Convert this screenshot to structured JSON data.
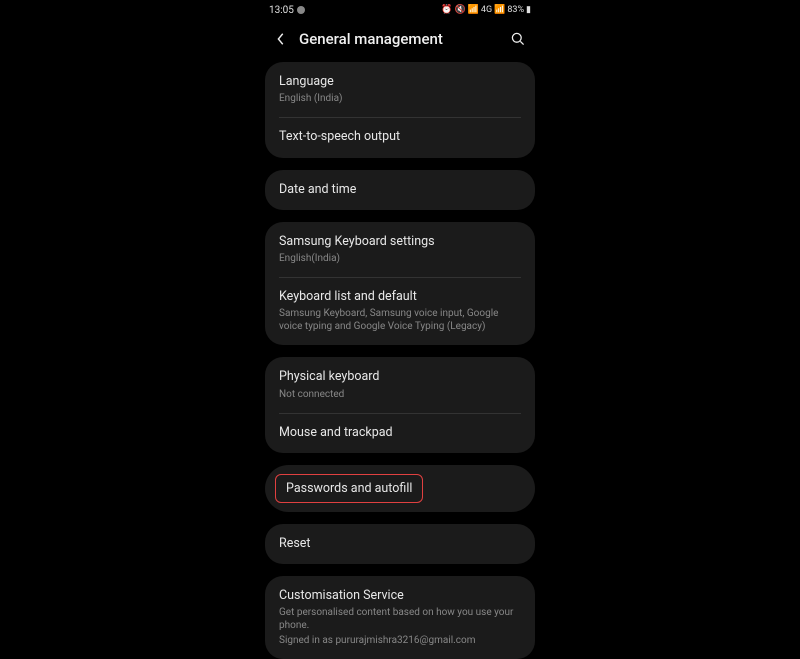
{
  "status": {
    "time": "13:05",
    "battery": "83%",
    "network": "4G"
  },
  "header": {
    "title": "General management"
  },
  "groups": [
    {
      "items": [
        {
          "title": "Language",
          "sub": "English (India)"
        },
        {
          "title": "Text-to-speech output"
        }
      ]
    },
    {
      "items": [
        {
          "title": "Date and time"
        }
      ]
    },
    {
      "items": [
        {
          "title": "Samsung Keyboard settings",
          "sub": "English(India)"
        },
        {
          "title": "Keyboard list and default",
          "sub": "Samsung Keyboard, Samsung voice input, Google voice typing and Google Voice Typing (Legacy)"
        }
      ]
    },
    {
      "items": [
        {
          "title": "Physical keyboard",
          "sub": "Not connected"
        },
        {
          "title": "Mouse and trackpad"
        }
      ]
    },
    {
      "highlight": true,
      "items": [
        {
          "title": "Passwords and autofill"
        }
      ]
    },
    {
      "items": [
        {
          "title": "Reset"
        }
      ]
    },
    {
      "items": [
        {
          "title": "Customisation Service",
          "sub": "Get personalised content based on how you use your phone.",
          "sub2": "Signed in as pururajmishra3216@gmail.com"
        }
      ]
    }
  ]
}
